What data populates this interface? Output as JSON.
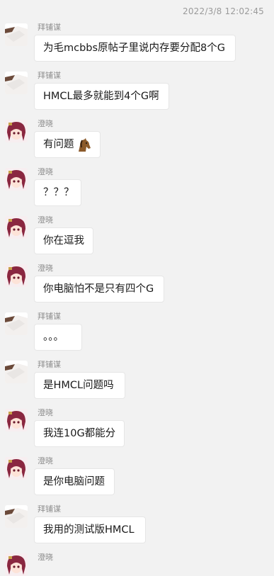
{
  "chat": {
    "timestamp": "2022/3/8 12:02:45",
    "messages": [
      {
        "sender": "拜铺谋",
        "avatar": "white-avatar",
        "text": "为毛mcbbs原帖子里说内存要分配8个G"
      },
      {
        "sender": "拜铺谋",
        "avatar": "white-avatar",
        "text": "HMCL最多就能到4个G啊"
      },
      {
        "sender": "澄晓",
        "avatar": "anime-avatar",
        "text": "有问题",
        "emoji": "horse-emoji"
      },
      {
        "sender": "澄晓",
        "avatar": "anime-avatar",
        "text": "？？？"
      },
      {
        "sender": "澄晓",
        "avatar": "anime-avatar",
        "text": "你在逗我"
      },
      {
        "sender": "澄晓",
        "avatar": "anime-avatar",
        "text": "你电脑怕不是只有四个G"
      },
      {
        "sender": "拜铺谋",
        "avatar": "white-avatar",
        "text": "。。。"
      },
      {
        "sender": "拜铺谋",
        "avatar": "white-avatar",
        "text": "是HMCL问题吗"
      },
      {
        "sender": "澄晓",
        "avatar": "anime-avatar",
        "text": "我连10G都能分"
      },
      {
        "sender": "澄晓",
        "avatar": "anime-avatar",
        "text": "是你电脑问题"
      },
      {
        "sender": "拜铺谋",
        "avatar": "white-avatar",
        "text": "我用的测试版HMCL"
      },
      {
        "sender": "澄晓",
        "avatar": "anime-avatar",
        "text": ""
      }
    ]
  }
}
